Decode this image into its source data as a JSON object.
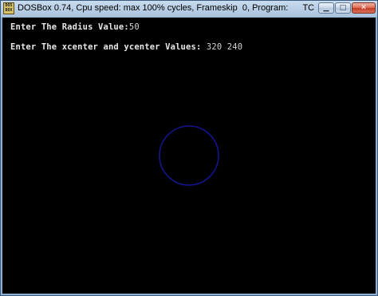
{
  "window": {
    "title": "DOSBox 0.74, Cpu speed: max 100% cycles, Frameskip  0, Program:      TC",
    "icon": "dosbox-icon",
    "icon_text": "DOS BOX",
    "controls": {
      "minimize": "▁",
      "maximize": "□",
      "close": "✕"
    }
  },
  "console": {
    "line1_prompt": "Enter The Radius Value:",
    "line1_value": "50",
    "line2_prompt": "Enter The xcenter and ycenter Values: ",
    "line2_value": "320 240"
  },
  "drawing": {
    "circle_color": "#14148c",
    "background_color": "#000000"
  }
}
